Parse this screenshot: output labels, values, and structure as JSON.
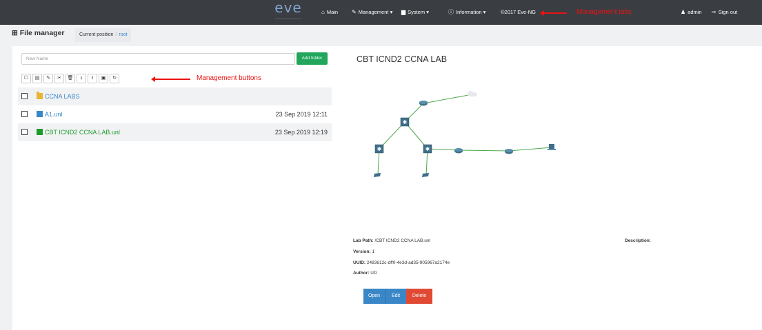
{
  "navbar": {
    "logo_text": "eve",
    "logo_subtitle": "emulated virtual environment",
    "items": [
      {
        "icon": "home-icon",
        "glyph": "⌂",
        "label": "Main"
      },
      {
        "icon": "wrench-icon",
        "glyph": "✎",
        "label": "Management ▾"
      },
      {
        "icon": "book-icon",
        "glyph": "▆",
        "label": "System ▾"
      },
      {
        "icon": "info-icon",
        "glyph": "ⓘ",
        "label": "Information ▾"
      }
    ],
    "copyright": "©2017 Eve-NG",
    "annotation": "Management tabs",
    "user": {
      "icon": "user-icon",
      "glyph": "♟",
      "label": "admin"
    },
    "signout": {
      "icon": "sign-out-icon",
      "glyph": "⇨",
      "label": "Sign out"
    }
  },
  "header": {
    "title_icon": "sitemap-icon",
    "title_glyph": "⊞",
    "title": "File manager",
    "breadcrumb_label": "Current position",
    "breadcrumb_sep": "/",
    "breadcrumb_current": "root"
  },
  "folder_form": {
    "placeholder": "New Name",
    "button": "Add folder"
  },
  "toolbar": {
    "buttons": [
      {
        "name": "select-all-icon",
        "glyph": "☐"
      },
      {
        "name": "new-file-icon",
        "glyph": "▤"
      },
      {
        "name": "rename-pencil-icon",
        "glyph": "✎"
      },
      {
        "name": "cut-scissors-icon",
        "glyph": "✂"
      },
      {
        "name": "delete-trash-icon",
        "glyph": "🗑"
      },
      {
        "name": "export-icon",
        "glyph": "⭳"
      },
      {
        "name": "import-icon",
        "glyph": "⭱"
      },
      {
        "name": "save-icon",
        "glyph": "▣"
      },
      {
        "name": "refresh-icon",
        "glyph": "↻"
      }
    ],
    "annotation": "Management buttons"
  },
  "files": [
    {
      "type": "folder",
      "name": "CCNA LABS",
      "date": "",
      "color": "#3a87c8"
    },
    {
      "type": "file",
      "name": "A1.unl",
      "date": "23 Sep 2019 12:11",
      "color": "#3a87c8"
    },
    {
      "type": "file",
      "name": "CBT ICND2 CCNA LAB.unl",
      "date": "23 Sep 2019 12:19",
      "color": "#1c9a2a"
    }
  ],
  "preview": {
    "title": "CBT ICND2 CCNA LAB",
    "lab_path_label": "Lab Path:",
    "lab_path": "/CBT ICND2 CCNA LAB.unl",
    "version_label": "Version:",
    "version": "1",
    "uuid_label": "UUID:",
    "uuid": "2483612c-dff0-4e3d-ad35-905967a2174e",
    "author_label": "Author:",
    "author": "UD",
    "description_label": "Description:",
    "buttons": {
      "open": "Open",
      "edit": "Edit",
      "delete": "Delete"
    }
  },
  "colors": {
    "navbar_bg": "#3a3d42",
    "accent_green": "#21a65b",
    "link_blue": "#3a87c8",
    "file_green": "#1c9a2a",
    "annotation_red": "#ee1111",
    "open_button": "#3a87c8",
    "edit_button": "#3a87c8",
    "delete_button": "#e04a35"
  }
}
